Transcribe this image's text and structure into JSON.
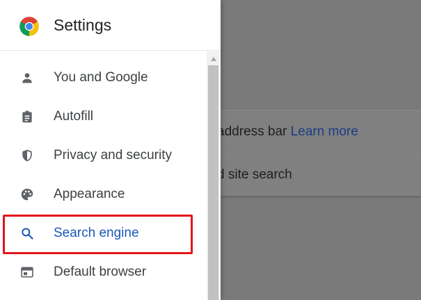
{
  "background": {
    "row1_text": "address bar ",
    "row1_link": "Learn more",
    "row2_text": "d site search"
  },
  "drawer": {
    "title": "Settings",
    "logo_icon": "chrome-logo",
    "items": [
      {
        "label": "You and Google",
        "icon": "person-icon",
        "selected": false
      },
      {
        "label": "Autofill",
        "icon": "clipboard-icon",
        "selected": false
      },
      {
        "label": "Privacy and security",
        "icon": "shield-icon",
        "selected": false
      },
      {
        "label": "Appearance",
        "icon": "palette-icon",
        "selected": false
      },
      {
        "label": "Search engine",
        "icon": "search-icon",
        "selected": true
      },
      {
        "label": "Default browser",
        "icon": "browser-window-icon",
        "selected": false
      }
    ]
  },
  "colors": {
    "accent": "#1a57b8",
    "highlight_box": "#e3141b",
    "icon": "#5f6368",
    "scrim": "#7a7a7a"
  }
}
